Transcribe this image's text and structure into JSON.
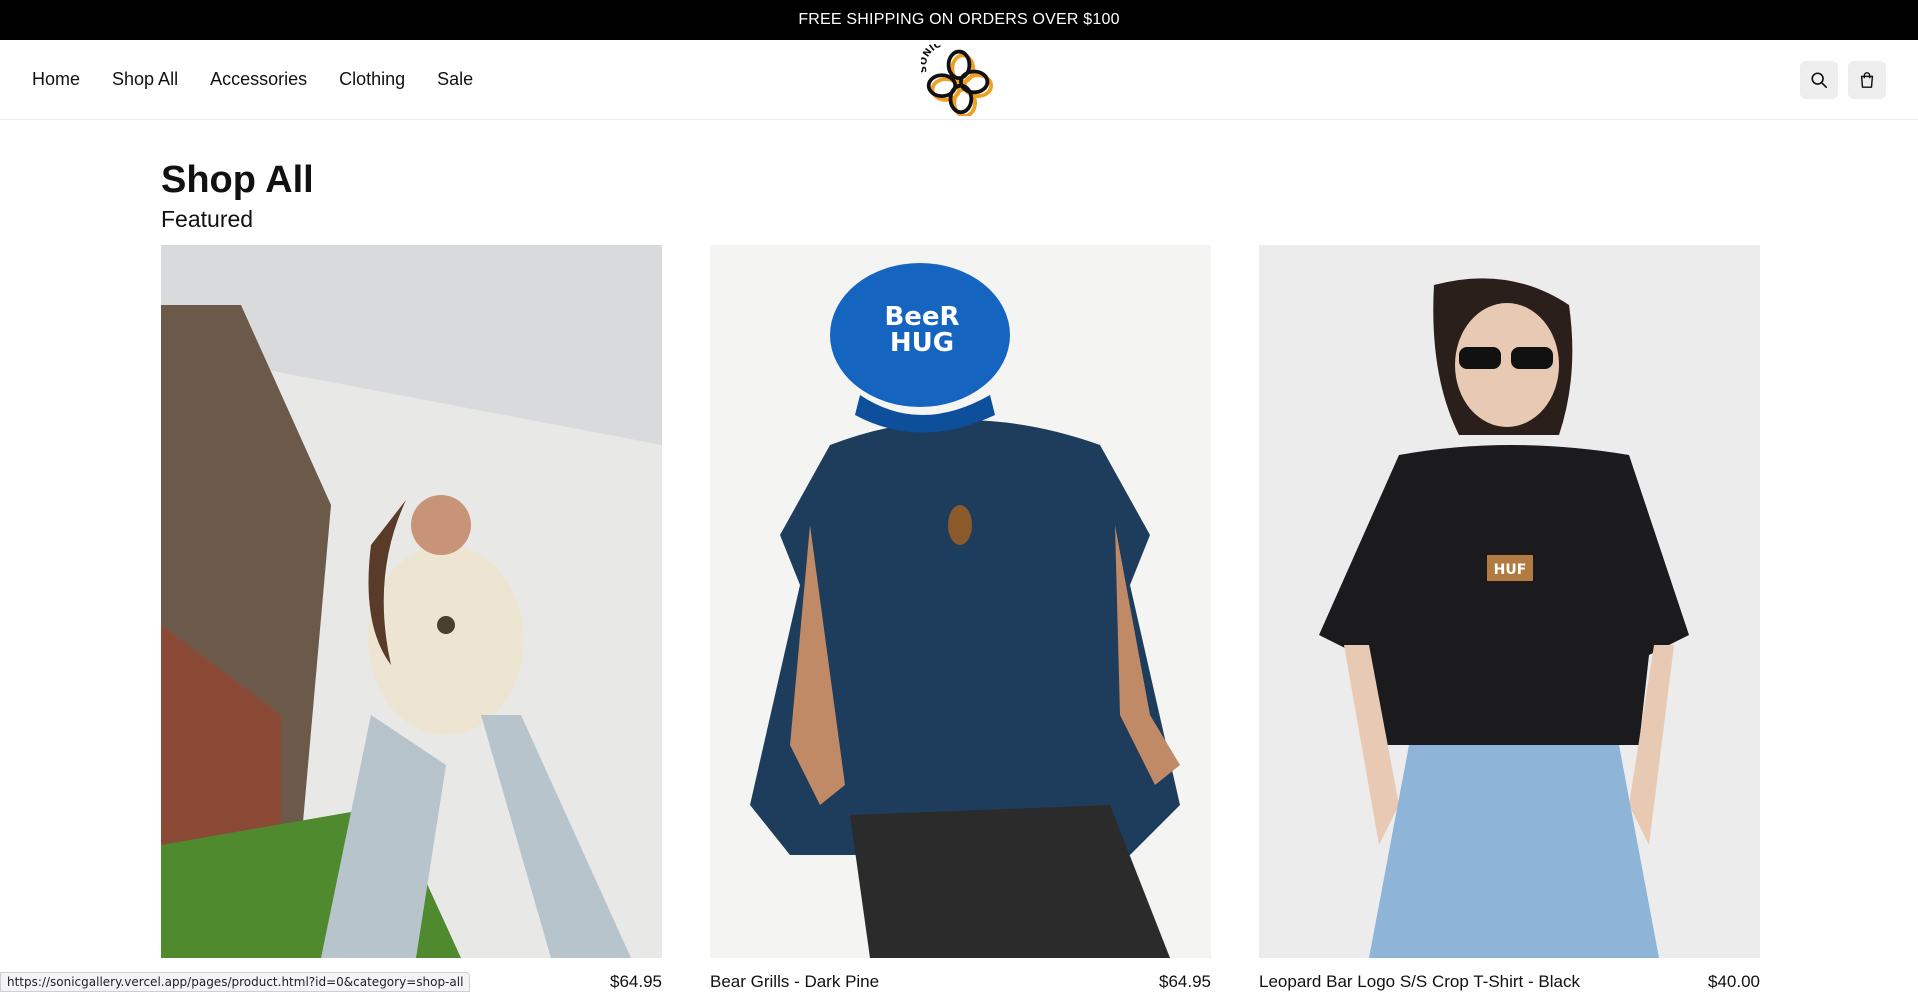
{
  "promo": {
    "text": "FREE SHIPPING ON ORDERS OVER $100"
  },
  "nav": {
    "items": [
      {
        "label": "Home"
      },
      {
        "label": "Shop All"
      },
      {
        "label": "Accessories"
      },
      {
        "label": "Clothing"
      },
      {
        "label": "Sale"
      }
    ]
  },
  "logo": {
    "text": "SONIC"
  },
  "header_actions": {
    "search_icon": "search-icon",
    "cart_icon": "cart-icon"
  },
  "page": {
    "title": "Shop All",
    "section": "Featured"
  },
  "products": [
    {
      "name": "",
      "price": "$64.95",
      "image": "woman-in-cream-tee-and-wide-jeans"
    },
    {
      "name": "Bear Grills - Dark Pine",
      "price": "$64.95",
      "image": "man-in-navy-tee-and-blue-beer-hug-cap"
    },
    {
      "name": "Leopard Bar Logo S/S Crop T-Shirt - Black",
      "price": "$40.00",
      "image": "woman-in-black-crop-tee-and-sunglasses"
    }
  ],
  "status_bar": {
    "url": "https://sonicgallery.vercel.app/pages/product.html?id=0&category=shop-all"
  },
  "colors": {
    "promo_bg": "#000000",
    "logo_orange": "#f0a020",
    "cap_blue": "#1565c0",
    "tee_navy": "#1e3d5c"
  }
}
